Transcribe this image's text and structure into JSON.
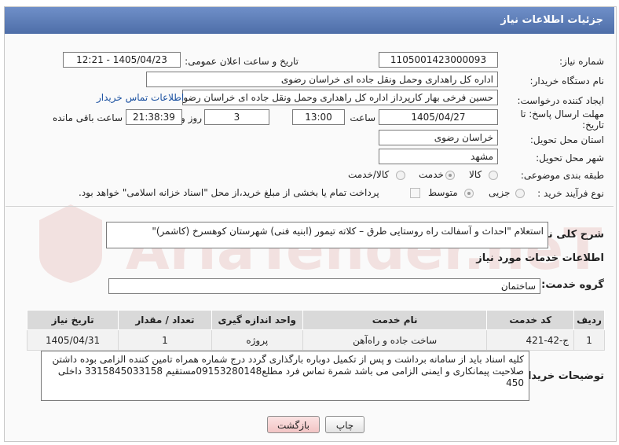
{
  "header": {
    "title": "جزئیات اطلاعات نیاز"
  },
  "form": {
    "need_number_label": "شماره نیاز:",
    "need_number": "1105001423000093",
    "announce_label": "تاریخ و ساعت اعلان عمومی:",
    "announce_value": "1405/04/23 - 12:21",
    "buyer_org_label": "نام دستگاه خریدار:",
    "buyer_org": "اداره کل راهداری وحمل ونقل جاده ای خراسان رضوی",
    "requester_label": "ایجاد کننده درخواست:",
    "requester": "حسین فرخی بهار کارپرداز اداره کل راهداری وحمل ونقل جاده ای خراسان رضوی",
    "contact_link": "اطلاعات تماس خریدار",
    "deadline_label_line1": "مهلت ارسال پاسخ: تا",
    "deadline_label_line2": "تاریخ:",
    "deadline_date": "1405/04/27",
    "time_label": "ساعت",
    "deadline_time": "13:00",
    "days_value": "3",
    "days_label": "روز و",
    "remaining_time": "21:38:39",
    "remaining_label": "ساعت باقی مانده",
    "province_label": "استان محل تحویل:",
    "province": "خراسان رضوی",
    "city_label": "شهر محل تحویل:",
    "city": "مشهد",
    "category_label": "طبقه بندی موضوعی:",
    "category_options": [
      "کالا",
      "خدمت",
      "کالا/خدمت"
    ],
    "category_selected": "خدمت",
    "process_label": "نوع فرآیند خرید :",
    "process_options": [
      "جزیی",
      "متوسط"
    ],
    "process_selected": "متوسط",
    "payment_note": "پرداخت تمام یا بخشی از مبلغ خرید،از محل \"اسناد خزانه اسلامی\" خواهد بود."
  },
  "summary": {
    "label": "شرح کلی نیاز:",
    "text": "استعلام \"احداث و آسفالت راه روستایی طرق – کلاته تیمور (ابنیه فنی) شهرستان کوهسرخ (کاشمر)\""
  },
  "services": {
    "section_title": "اطلاعات خدمات مورد نیاز",
    "group_label": "گروه خدمت:",
    "group_value": "ساختمان",
    "columns": [
      "ردیف",
      "کد خدمت",
      "نام خدمت",
      "واحد اندازه گیری",
      "تعداد / مقدار",
      "تاریخ نیاز"
    ],
    "rows": [
      [
        "1",
        "ج-42-421",
        "ساخت جاده و راه‌آهن",
        "پروژه",
        "1",
        "1405/04/31"
      ]
    ]
  },
  "buyer_notes": {
    "label": "توضیحات خریدار:",
    "text": "کلیه اسناد باید از سامانه برداشت و پس از تکمیل دوباره بارگذاری گردد درج شماره همراه تامین کننده الزامی بوده داشتن صلاحیت پیمانکاری و ایمنی الزامی می باشد  شمرة تماس فرد مطلع09153280148مستقیم 3315845033158 داخلی 450"
  },
  "buttons": {
    "print": "چاپ",
    "back": "بازگشت"
  },
  "watermark": {
    "text": "AriaTender.neT"
  },
  "colors": {
    "header": "#5a7ab5",
    "back_button": "#f7d2d2",
    "link": "#1a50a0"
  }
}
